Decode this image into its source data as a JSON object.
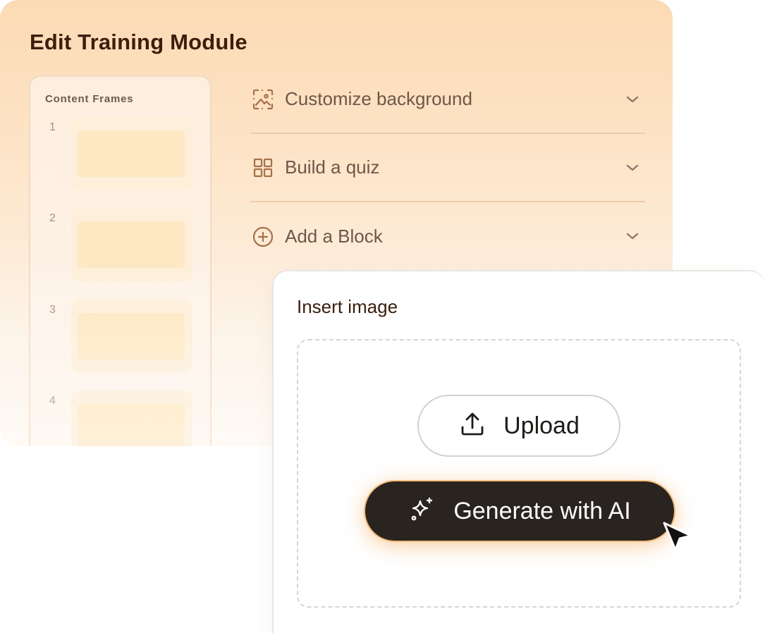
{
  "module": {
    "title": "Edit Training Module"
  },
  "frames": {
    "title": "Content Frames",
    "items": [
      {
        "number": "1"
      },
      {
        "number": "2"
      },
      {
        "number": "3"
      },
      {
        "number": "4"
      }
    ]
  },
  "accordion": {
    "items": [
      {
        "label": "Customize background",
        "icon": "image-frame-icon"
      },
      {
        "label": "Build a quiz",
        "icon": "grid-icon"
      },
      {
        "label": "Add a Block",
        "icon": "plus-circle-icon"
      }
    ]
  },
  "insert": {
    "title": "Insert image",
    "upload_label": "Upload",
    "upload_icon": "upload-icon",
    "generate_label": "Generate with AI",
    "generate_icon": "sparkles-icon"
  },
  "colors": {
    "accent": "#f2bd7d",
    "brand_dark": "#292420",
    "title_text": "#3b1e0b",
    "icon_brown": "#a5714a"
  }
}
